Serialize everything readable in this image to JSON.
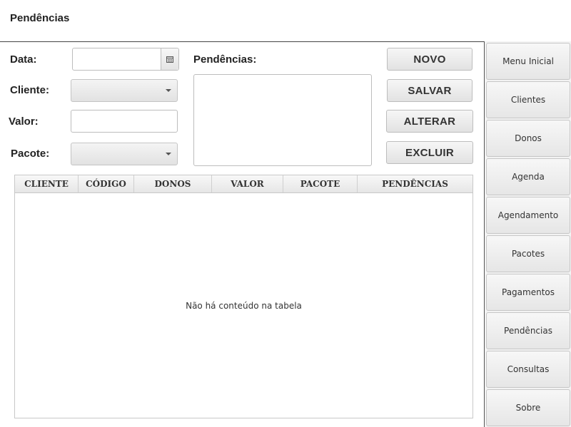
{
  "window": {
    "title": "Pendências"
  },
  "form": {
    "data_label": "Data:",
    "cliente_label": "Cliente:",
    "valor_label": "Valor:",
    "pacote_label": "Pacote:",
    "pendencias_label": "Pendências:",
    "data_value": "",
    "valor_value": "",
    "pendencias_value": "",
    "cliente_selected": "",
    "pacote_selected": ""
  },
  "actions": {
    "novo": "NOVO",
    "salvar": "SALVAR",
    "alterar": "ALTERAR",
    "excluir": "EXCLUIR"
  },
  "table": {
    "columns": [
      "CLIENTE",
      "CÓDIGO",
      "DONOS",
      "VALOR",
      "PACOTE",
      "PENDÊNCIAS"
    ],
    "rows": [],
    "empty_message": "Não há conteúdo na tabela"
  },
  "sidebar": {
    "items": [
      {
        "label": "Menu Inicial"
      },
      {
        "label": "Clientes"
      },
      {
        "label": "Donos"
      },
      {
        "label": "Agenda"
      },
      {
        "label": "Agendamento"
      },
      {
        "label": "Pacotes"
      },
      {
        "label": "Pagamentos"
      },
      {
        "label": "Pendências"
      },
      {
        "label": "Consultas"
      },
      {
        "label": "Sobre"
      }
    ]
  },
  "icons": {
    "date_picker": "calendar-icon",
    "combo_arrow": "chevron-down-icon"
  }
}
